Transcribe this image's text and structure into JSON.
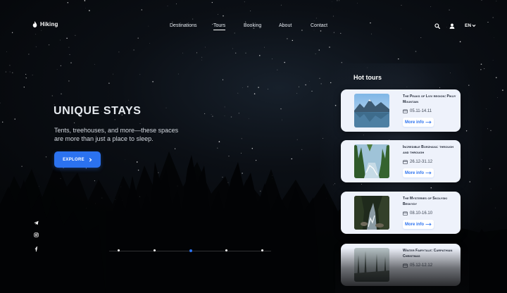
{
  "header": {
    "logo_text": "Hiking",
    "nav": [
      {
        "label": "Destinations",
        "active": false
      },
      {
        "label": "Tours",
        "active": true
      },
      {
        "label": "Booking",
        "active": false
      },
      {
        "label": "About",
        "active": false
      },
      {
        "label": "Contact",
        "active": false
      }
    ],
    "icons": [
      "search-icon",
      "user-icon"
    ],
    "language": "EN"
  },
  "hero": {
    "title": "UNIQUE STAYS",
    "subtitle": "Tents, treehouses, and more—these spaces are more than just a place to sleep.",
    "button_label": "EXPLORE"
  },
  "socials": [
    "telegram-icon",
    "instagram-icon",
    "facebook-icon"
  ],
  "slider": {
    "count": 5,
    "active_index": 2
  },
  "hot_tours": {
    "heading": "Hot tours",
    "more_label": "More info",
    "cards": [
      {
        "title": "The Peaks of Lviv region: Pikuy Mountain",
        "dates": "05.11-14.11",
        "image": "mountain-lake"
      },
      {
        "title": "Incredible Borzhava: through and through",
        "dates": "26.12-31.12",
        "image": "forest-river"
      },
      {
        "title": "The Mysteries of Skolyski Beskydy",
        "dates": "08.10-16.10",
        "image": "forest-stream"
      },
      {
        "title": "Winter Fairytale: Carpathian Christmas",
        "dates": "05.12-12.12",
        "image": "misty-forest"
      }
    ]
  },
  "colors": {
    "accent": "#2b72f0",
    "card_bg": "#eef2fb",
    "text_dark": "#1d2433"
  }
}
